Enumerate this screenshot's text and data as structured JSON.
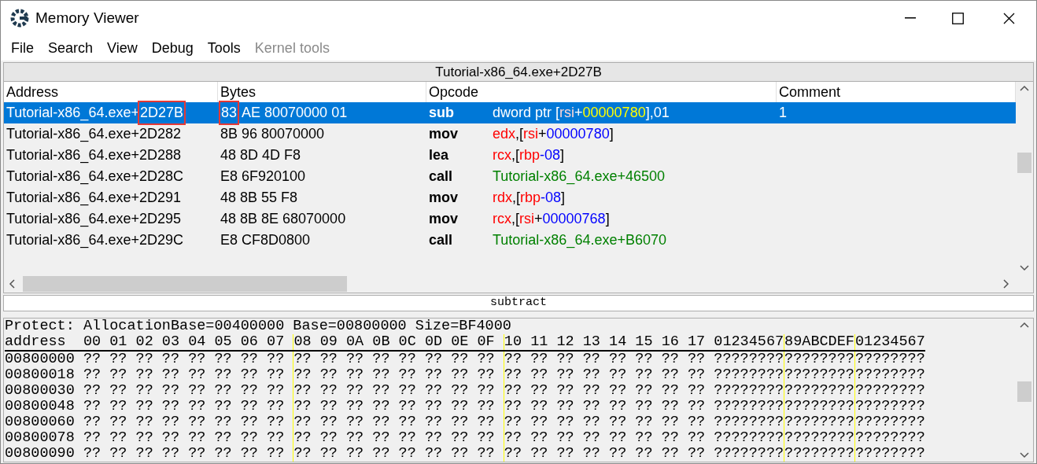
{
  "window": {
    "title": "Memory Viewer"
  },
  "menu": [
    {
      "label": "File",
      "disabled": false
    },
    {
      "label": "Search",
      "disabled": false
    },
    {
      "label": "View",
      "disabled": false
    },
    {
      "label": "Debug",
      "disabled": false
    },
    {
      "label": "Tools",
      "disabled": false
    },
    {
      "label": "Kernel tools",
      "disabled": true
    }
  ],
  "disassembler": {
    "location": "Tutorial-x86_64.exe+2D27B",
    "columns": [
      "Address",
      "Bytes",
      "Opcode",
      "Comment"
    ],
    "rows": [
      {
        "selected": true,
        "address": [
          {
            "text": "Tutorial-x86_64.exe+",
            "boxed": false
          },
          {
            "text": "2D27B",
            "boxed": true
          }
        ],
        "bytes": [
          {
            "text": "83",
            "boxed": true
          },
          {
            "text": "AE 80070000 01",
            "boxed": false
          }
        ],
        "mnemonic": "sub",
        "operands": [
          {
            "kind": "plain",
            "text": "dword ptr ["
          },
          {
            "kind": "register",
            "text": "rsi"
          },
          {
            "kind": "plain",
            "text": "+"
          },
          {
            "kind": "number",
            "text": "00000780"
          },
          {
            "kind": "plain",
            "text": "],01"
          }
        ],
        "comment": "1"
      },
      {
        "selected": false,
        "address": [
          {
            "text": "Tutorial-x86_64.exe+2D282",
            "boxed": false
          }
        ],
        "bytes": [
          {
            "text": "8B 96 80070000",
            "boxed": false
          }
        ],
        "mnemonic": "mov",
        "operands": [
          {
            "kind": "register",
            "text": "edx"
          },
          {
            "kind": "plain",
            "text": ",["
          },
          {
            "kind": "register",
            "text": "rsi"
          },
          {
            "kind": "plain",
            "text": "+"
          },
          {
            "kind": "number",
            "text": "00000780"
          },
          {
            "kind": "plain",
            "text": "]"
          }
        ]
      },
      {
        "selected": false,
        "address": [
          {
            "text": "Tutorial-x86_64.exe+2D288",
            "boxed": false
          }
        ],
        "bytes": [
          {
            "text": "48 8D 4D F8",
            "boxed": false
          }
        ],
        "mnemonic": "lea",
        "operands": [
          {
            "kind": "register",
            "text": "rcx"
          },
          {
            "kind": "plain",
            "text": ",["
          },
          {
            "kind": "register",
            "text": "rbp"
          },
          {
            "kind": "number",
            "text": "-08"
          },
          {
            "kind": "plain",
            "text": "]"
          }
        ]
      },
      {
        "selected": false,
        "address": [
          {
            "text": "Tutorial-x86_64.exe+2D28C",
            "boxed": false
          }
        ],
        "bytes": [
          {
            "text": "E8 6F920100",
            "boxed": false
          }
        ],
        "mnemonic": "call",
        "operands": [
          {
            "kind": "symbol",
            "text": "Tutorial-x86_64.exe+46500"
          }
        ]
      },
      {
        "selected": false,
        "address": [
          {
            "text": "Tutorial-x86_64.exe+2D291",
            "boxed": false
          }
        ],
        "bytes": [
          {
            "text": "48 8B 55 F8",
            "boxed": false
          }
        ],
        "mnemonic": "mov",
        "operands": [
          {
            "kind": "register",
            "text": "rdx"
          },
          {
            "kind": "plain",
            "text": ",["
          },
          {
            "kind": "register",
            "text": "rbp"
          },
          {
            "kind": "number",
            "text": "-08"
          },
          {
            "kind": "plain",
            "text": "]"
          }
        ]
      },
      {
        "selected": false,
        "address": [
          {
            "text": "Tutorial-x86_64.exe+2D295",
            "boxed": false
          }
        ],
        "bytes": [
          {
            "text": "48 8B 8E 68070000",
            "boxed": false
          }
        ],
        "mnemonic": "mov",
        "operands": [
          {
            "kind": "register",
            "text": "rcx"
          },
          {
            "kind": "plain",
            "text": ",["
          },
          {
            "kind": "register",
            "text": "rsi"
          },
          {
            "kind": "plain",
            "text": "+"
          },
          {
            "kind": "number",
            "text": "00000768"
          },
          {
            "kind": "plain",
            "text": "]"
          }
        ]
      },
      {
        "selected": false,
        "address": [
          {
            "text": "Tutorial-x86_64.exe+2D29C",
            "boxed": false
          }
        ],
        "bytes": [
          {
            "text": "E8 CF8D0800",
            "boxed": false
          }
        ],
        "mnemonic": "call",
        "operands": [
          {
            "kind": "symbol",
            "text": "Tutorial-x86_64.exe+B6070"
          }
        ]
      }
    ],
    "description": "subtract"
  },
  "hex_view": {
    "info": "Protect: AllocationBase=00400000 Base=00800000 Size=BF4000",
    "header": {
      "address": "address",
      "groups": [
        "00 01 02 03 04 05 06 07",
        "08 09 0A 0B 0C 0D 0E 0F",
        "10 11 12 13 14 15 16 17"
      ],
      "ascii": [
        "01234567",
        "89ABCDEF",
        "01234567"
      ]
    },
    "rows": [
      {
        "address": "00800000",
        "groups": [
          "?? ?? ?? ?? ?? ?? ?? ??",
          "?? ?? ?? ?? ?? ?? ?? ??",
          "?? ?? ?? ?? ?? ?? ?? ??"
        ],
        "ascii": [
          "????????",
          "????????",
          "????????"
        ]
      },
      {
        "address": "00800018",
        "groups": [
          "?? ?? ?? ?? ?? ?? ?? ??",
          "?? ?? ?? ?? ?? ?? ?? ??",
          "?? ?? ?? ?? ?? ?? ?? ??"
        ],
        "ascii": [
          "????????",
          "????????",
          "????????"
        ]
      },
      {
        "address": "00800030",
        "groups": [
          "?? ?? ?? ?? ?? ?? ?? ??",
          "?? ?? ?? ?? ?? ?? ?? ??",
          "?? ?? ?? ?? ?? ?? ?? ??"
        ],
        "ascii": [
          "????????",
          "????????",
          "????????"
        ]
      },
      {
        "address": "00800048",
        "groups": [
          "?? ?? ?? ?? ?? ?? ?? ??",
          "?? ?? ?? ?? ?? ?? ?? ??",
          "?? ?? ?? ?? ?? ?? ?? ??"
        ],
        "ascii": [
          "????????",
          "????????",
          "????????"
        ]
      },
      {
        "address": "00800060",
        "groups": [
          "?? ?? ?? ?? ?? ?? ?? ??",
          "?? ?? ?? ?? ?? ?? ?? ??",
          "?? ?? ?? ?? ?? ?? ?? ??"
        ],
        "ascii": [
          "????????",
          "????????",
          "????????"
        ]
      },
      {
        "address": "00800078",
        "groups": [
          "?? ?? ?? ?? ?? ?? ?? ??",
          "?? ?? ?? ?? ?? ?? ?? ??",
          "?? ?? ?? ?? ?? ?? ?? ??"
        ],
        "ascii": [
          "????????",
          "????????",
          "????????"
        ]
      },
      {
        "address": "00800090",
        "groups": [
          "?? ?? ?? ?? ?? ?? ?? ??",
          "?? ?? ?? ?? ?? ?? ?? ??",
          "?? ?? ?? ?? ?? ?? ?? ??"
        ],
        "ascii": [
          "????????",
          "????????",
          "????????"
        ]
      }
    ]
  }
}
